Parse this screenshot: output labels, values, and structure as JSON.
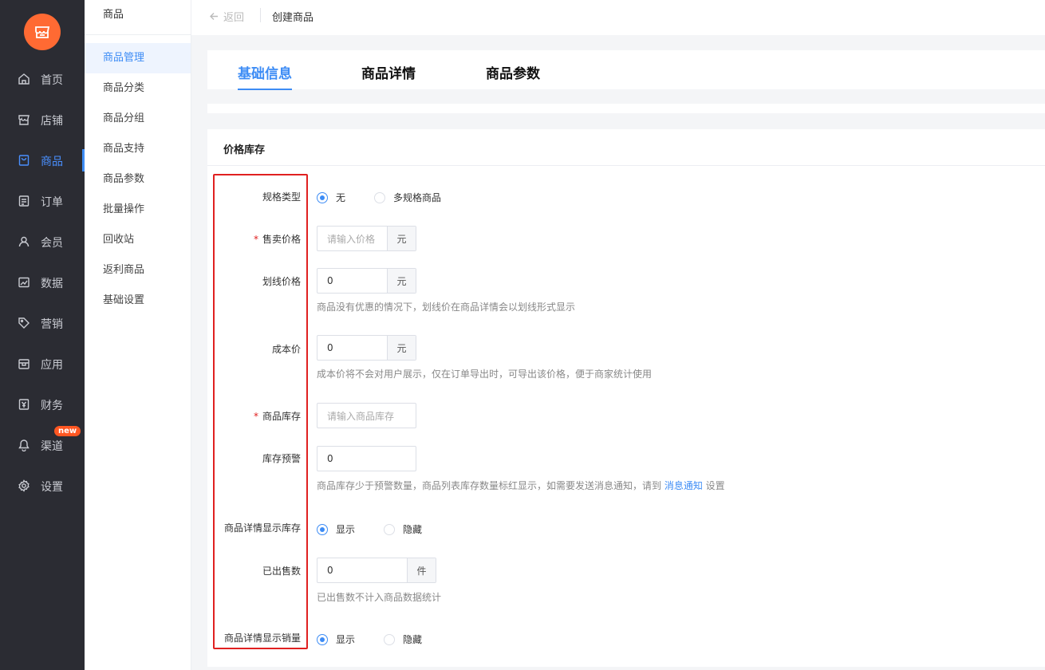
{
  "nav": {
    "items": [
      {
        "label": "首页",
        "icon": "home-icon"
      },
      {
        "label": "店铺",
        "icon": "store-icon"
      },
      {
        "label": "商品",
        "icon": "goods-icon",
        "active": true
      },
      {
        "label": "订单",
        "icon": "order-icon"
      },
      {
        "label": "会员",
        "icon": "member-icon"
      },
      {
        "label": "数据",
        "icon": "chart-icon"
      },
      {
        "label": "营销",
        "icon": "tag-icon"
      },
      {
        "label": "应用",
        "icon": "app-icon"
      },
      {
        "label": "财务",
        "icon": "finance-icon"
      },
      {
        "label": "渠道",
        "icon": "channel-icon",
        "badge": "new"
      },
      {
        "label": "设置",
        "icon": "settings-icon"
      }
    ],
    "accent": "#3d8cf5",
    "logo_color": "#ff6a33"
  },
  "submenu": {
    "title": "商品",
    "items": [
      "商品管理",
      "商品分类",
      "商品分组",
      "商品支持",
      "商品参数",
      "批量操作",
      "回收站",
      "返利商品",
      "基础设置"
    ],
    "active_index": 0
  },
  "topbar": {
    "back_label": "返回",
    "breadcrumb": "创建商品"
  },
  "tabs": [
    "基础信息",
    "商品详情",
    "商品参数"
  ],
  "section": {
    "title": "价格库存",
    "spec_type": {
      "label": "规格类型",
      "options": [
        "无",
        "多规格商品"
      ],
      "selected": 0
    },
    "sale_price": {
      "label": "售卖价格",
      "required": true,
      "placeholder": "请输入价格",
      "suffix": "元"
    },
    "list_price": {
      "label": "划线价格",
      "value": "0",
      "suffix": "元",
      "help": "商品没有优惠的情况下，划线价在商品详情会以划线形式显示"
    },
    "cost_price": {
      "label": "成本价",
      "value": "0",
      "suffix": "元",
      "help": "成本价将不会对用户展示，仅在订单导出时，可导出该价格，便于商家统计使用"
    },
    "stock": {
      "label": "商品库存",
      "required": true,
      "placeholder": "请输入商品库存"
    },
    "stock_alert": {
      "label": "库存预警",
      "value": "0",
      "help_prefix": "商品库存少于预警数量，商品列表库存数量标红显示，如需要发送消息通知，请到 ",
      "help_link": "消息通知",
      "help_suffix": " 设置"
    },
    "show_stock": {
      "label": "商品详情显示库存",
      "options": [
        "显示",
        "隐藏"
      ],
      "selected": 0
    },
    "sold": {
      "label": "已出售数",
      "value": "0",
      "suffix": "件",
      "help": "已出售数不计入商品数据统计"
    },
    "show_sales": {
      "label": "商品详情显示销量",
      "options": [
        "显示",
        "隐藏"
      ],
      "selected": 0
    }
  }
}
